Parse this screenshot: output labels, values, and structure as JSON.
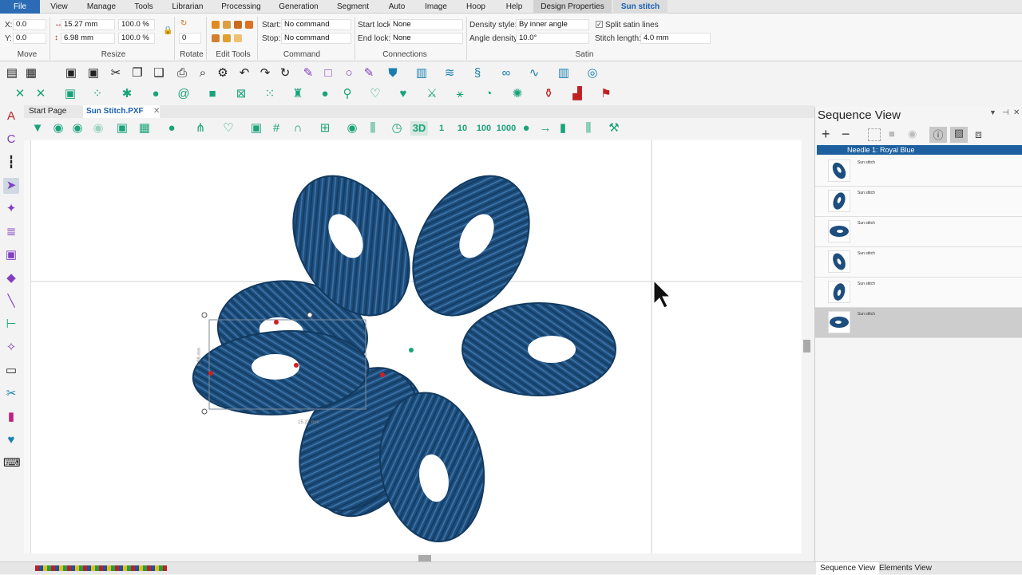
{
  "menu": {
    "file": "File",
    "view": "View",
    "manage": "Manage",
    "tools": "Tools",
    "librarian": "Librarian",
    "processing": "Processing",
    "generation": "Generation",
    "segment": "Segment",
    "auto": "Auto",
    "image": "Image",
    "hoop": "Hoop",
    "help": "Help",
    "design_properties": "Design Properties",
    "sun_stitch": "Sun stitch"
  },
  "ribbon": {
    "x_label": "X:",
    "x_value": "0.0",
    "y_label": "Y:",
    "y_value": "0.0",
    "width_value": "15.27 mm",
    "height_value": "6.98 mm",
    "width_pct": "100.0 %",
    "height_pct": "100.0 %",
    "rotate_value": "0",
    "start_label": "Start:",
    "start_value": "No command",
    "stop_label": "Stop:",
    "stop_value": "No command",
    "start_lock_label": "Start lock:",
    "start_lock_value": "None",
    "end_lock_label": "End lock:",
    "end_lock_value": "None",
    "density_style_label": "Density style:",
    "density_style_value": "By inner angle",
    "angle_density_label": "Angle density:",
    "angle_density_value": "10.0°",
    "split_satin_label": "Split satin lines",
    "stitch_length_label": "Stitch length:",
    "stitch_length_value": "4.0 mm",
    "groups": {
      "move": "Move",
      "resize": "Resize",
      "rotate": "Rotate",
      "edit_tools": "Edit Tools",
      "command": "Command",
      "connections": "Connections",
      "satin": "Satin"
    }
  },
  "tabs": {
    "start_page": "Start Page",
    "document": "Sun Stitch.PXF"
  },
  "view_toolbar": {
    "one": "1",
    "ten": "10",
    "hundred": "100",
    "thousand": "1000",
    "three_d": "3D"
  },
  "canvas": {
    "height_dim": "6.98 mm",
    "width_dim": "15.27 mm"
  },
  "sequence": {
    "title": "Sequence View",
    "needle": "Needle 1: Royal Blue",
    "items": [
      {
        "label": "Sun stitch"
      },
      {
        "label": "Sun stitch"
      },
      {
        "label": "Sun stitch"
      },
      {
        "label": "Sun stitch"
      },
      {
        "label": "Sun stitch"
      },
      {
        "label": "Sun stitch"
      }
    ]
  },
  "bottom_tabs": {
    "sequence_view": "Sequence View",
    "elements_view": "Elements View"
  },
  "colors": {
    "thread": "#1d4e7d",
    "accent": "#1a5fb4",
    "icon_green": "#1aa37a"
  }
}
